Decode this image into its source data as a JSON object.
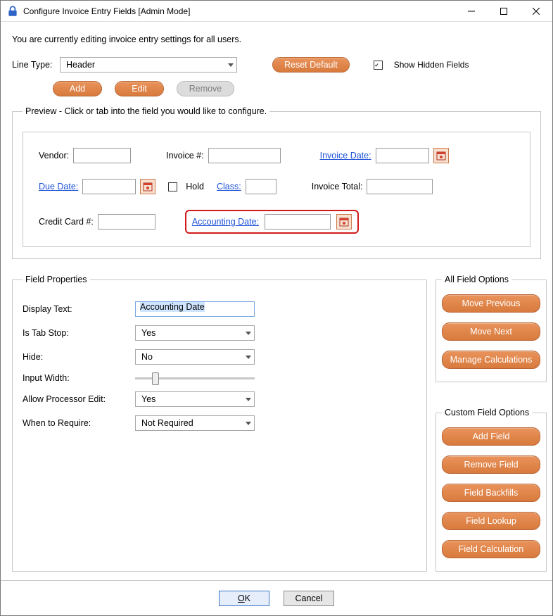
{
  "window": {
    "title": "Configure Invoice Entry Fields [Admin Mode]"
  },
  "intro": "You are currently editing invoice entry settings for all users.",
  "line_type": {
    "label": "Line Type:",
    "value": "Header"
  },
  "buttons": {
    "reset_default": "Reset Default",
    "add": "Add",
    "edit": "Edit",
    "remove": "Remove"
  },
  "show_hidden": {
    "label": "Show Hidden Fields",
    "checked": true
  },
  "preview": {
    "legend_prefix": "Preview - ",
    "legend": "Click or tab into the field you would like to configure.",
    "fields": {
      "vendor": "Vendor:",
      "invoice_num": "Invoice #:",
      "invoice_date": "Invoice Date:",
      "due_date": "Due Date:",
      "hold": "Hold",
      "class": "Class:",
      "invoice_total": "Invoice Total:",
      "credit_card": "Credit Card #:",
      "accounting_date": "Accounting Date:"
    }
  },
  "field_properties": {
    "legend": "Field Properties",
    "display_text": {
      "label": "Display Text:",
      "value": "Accounting Date"
    },
    "is_tab_stop": {
      "label": "Is Tab Stop:",
      "value": "Yes"
    },
    "hide": {
      "label": "Hide:",
      "value": "No"
    },
    "input_width": {
      "label": "Input Width:"
    },
    "allow_processor_edit": {
      "label": "Allow Processor Edit:",
      "value": "Yes"
    },
    "when_to_require": {
      "label": "When to Require:",
      "value": "Not Required"
    }
  },
  "all_field_options": {
    "legend": "All Field Options",
    "move_previous": "Move Previous",
    "move_next": "Move Next",
    "manage_calculations": "Manage Calculations"
  },
  "custom_field_options": {
    "legend": "Custom Field Options",
    "add_field": "Add Field",
    "remove_field": "Remove Field",
    "field_backfills": "Field Backfills",
    "field_lookup": "Field Lookup",
    "field_calculation": "Field Calculation"
  },
  "footer": {
    "ok": "OK",
    "cancel": "Cancel"
  }
}
